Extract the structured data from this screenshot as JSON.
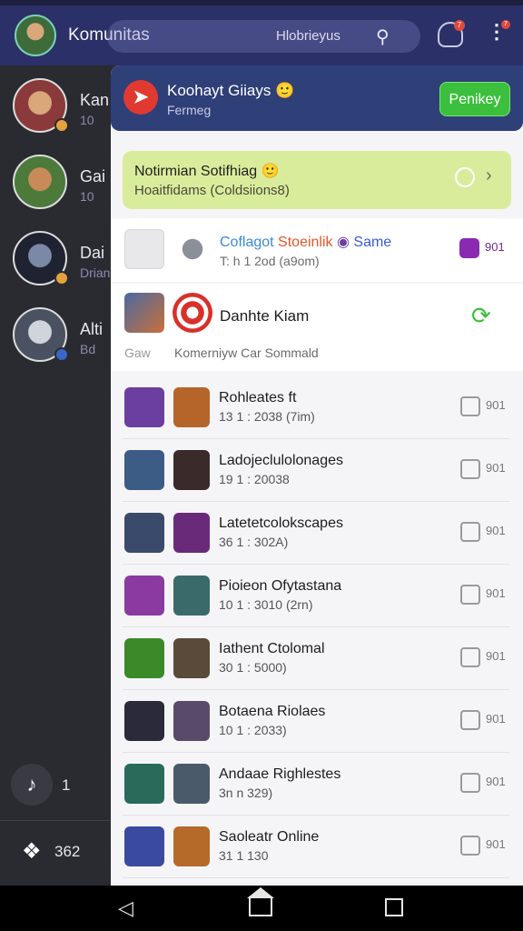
{
  "topbar": {
    "title": "Komunitas",
    "search_text": "Hlobrieyus",
    "bell_badge": "7",
    "more_badge": "7"
  },
  "sidebar": {
    "items": [
      {
        "name": "Kan",
        "sub": "10",
        "avatar_color": "#c98a5a",
        "badge_color": "#e6a23c"
      },
      {
        "name": "Gai",
        "sub": "10",
        "avatar_color": "#4b7a3a",
        "badge_color": ""
      },
      {
        "name": "Dai",
        "sub": "Drian",
        "avatar_color": "#3a3f52",
        "badge_color": "#e6a23c"
      },
      {
        "name": "Alti",
        "sub": "Bd",
        "avatar_color": "#7a8596",
        "badge_color": "#3a66c8"
      }
    ],
    "bottom1": {
      "icon": "tiktok-icon",
      "count": "1"
    },
    "bottom2": {
      "icon": "twitter-icon",
      "count": "362"
    }
  },
  "panel": {
    "header": {
      "title": "Koohayt Giiays",
      "emoji": "🙂",
      "subtitle": "Fermeg",
      "button": "Penikey"
    },
    "notification": {
      "title": "Notirmian Sotifhiag",
      "emoji": "🙂",
      "subtitle": "Hoaitfidams (Coldsiions8)"
    },
    "special_rows": [
      {
        "title_a": "Coflagot",
        "title_b": "Stoeinlik",
        "title_c": "Same",
        "subtitle": "T: h 1 2od (a9om)",
        "count": "901"
      },
      {
        "title": "Danhte Kiam",
        "tag": "Gaw",
        "subtitle": "Komerniyw Car Sommald"
      }
    ],
    "list": [
      {
        "name": "Rohleates ft",
        "sub": "13 1 : 2038 (7im)",
        "count": "901",
        "c1": "#6a3fa0",
        "c2": "#b5652a"
      },
      {
        "name": "Ladojeclulolonages",
        "sub": "19 1 : 20038",
        "count": "901",
        "c1": "#3c5c86",
        "c2": "#3a2a2a"
      },
      {
        "name": "Latetetcolokscapes",
        "sub": "36 1 : 302A)",
        "count": "901",
        "c1": "#3a4a6a",
        "c2": "#6a2a7a"
      },
      {
        "name": "Pioieon Ofytastana",
        "sub": "10 1 : 3010 (2rn)",
        "count": "901",
        "c1": "#8a3aa0",
        "c2": "#3a6a6a"
      },
      {
        "name": "Iathent Ctolomal",
        "sub": "30 1 : 5000)",
        "count": "901",
        "c1": "#3a8a2a",
        "c2": "#5a4a3a"
      },
      {
        "name": "Botaena Riolaes",
        "sub": "10 1 : 2033)",
        "count": "901",
        "c1": "#2a2a3a",
        "c2": "#5a4a6a"
      },
      {
        "name": "Andaae Righlestes",
        "sub": "3n n 329)",
        "count": "901",
        "c1": "#2a6a5a",
        "c2": "#4a5a6a"
      },
      {
        "name": "Saoleatr Online",
        "sub": "31 1 130",
        "count": "901",
        "c1": "#3a4aa0",
        "c2": "#b56a2a"
      }
    ]
  },
  "colors": {
    "topbar_bg": "#2b3068",
    "panel_header_bg": "#2f3f78",
    "accent_green": "#3cbf3c",
    "notification_bg": "#d9ec9c"
  }
}
